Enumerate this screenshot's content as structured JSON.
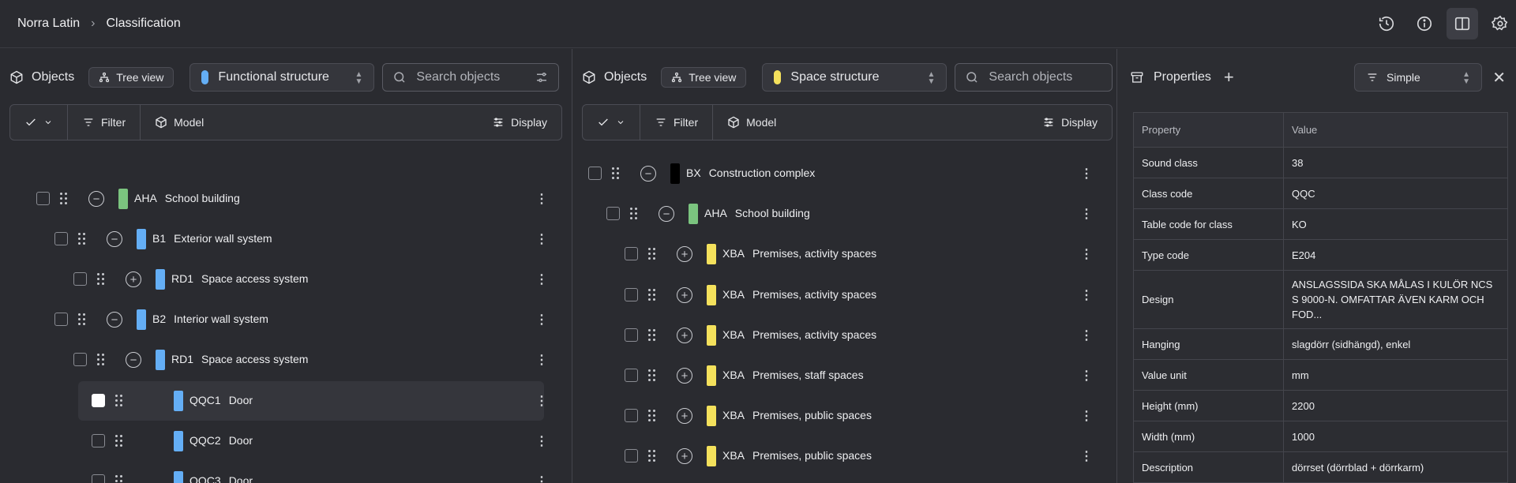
{
  "breadcrumb": {
    "project": "Norra Latin",
    "separator": "›",
    "page": "Classification"
  },
  "top_icons": [
    "history-icon",
    "info-icon",
    "split-view-icon",
    "settings-icon"
  ],
  "colors": {
    "green": "#7bc47f",
    "blue": "#64aef5",
    "yellow": "#f4e15c",
    "black": "#000000",
    "background": "#2a2b30"
  },
  "left_panel": {
    "objects_label": "Objects",
    "tree_view_label": "Tree view",
    "structure_label": "Functional structure",
    "structure_color": "#64aef5",
    "search_placeholder": "Search objects",
    "toolbar": {
      "filter": "Filter",
      "model": "Model",
      "display": "Display"
    },
    "rows": [
      {
        "code": "AHA",
        "name": "School building",
        "color": "#7bc47f",
        "toggle": "minus"
      },
      {
        "code": "B1",
        "name": "Exterior wall system",
        "color": "#64aef5",
        "toggle": "minus"
      },
      {
        "code": "RD1",
        "name": "Space access system",
        "color": "#64aef5",
        "toggle": "plus"
      },
      {
        "code": "B2",
        "name": "Interior wall system",
        "color": "#64aef5",
        "toggle": "minus"
      },
      {
        "code": "RD1",
        "name": "Space access system",
        "color": "#64aef5",
        "toggle": "minus"
      },
      {
        "code": "QQC1",
        "name": "Door",
        "color": "#64aef5",
        "toggle": "none",
        "selected": true
      },
      {
        "code": "QQC2",
        "name": "Door",
        "color": "#64aef5",
        "toggle": "none"
      },
      {
        "code": "QQC3",
        "name": "Door",
        "color": "#64aef5",
        "toggle": "none"
      }
    ]
  },
  "mid_panel": {
    "objects_label": "Objects",
    "tree_view_label": "Tree view",
    "structure_label": "Space structure",
    "structure_color": "#f4e15c",
    "search_placeholder": "Search objects",
    "toolbar": {
      "filter": "Filter",
      "model": "Model",
      "display": "Display"
    },
    "rows": [
      {
        "code": "BX",
        "name": "Construction complex",
        "color": "#000000",
        "toggle": "minus"
      },
      {
        "code": "AHA",
        "name": "School building",
        "color": "#7bc47f",
        "toggle": "minus"
      },
      {
        "code": "XBA",
        "name": "Premises, activity spaces",
        "color": "#f4e15c",
        "toggle": "plus"
      },
      {
        "code": "XBA",
        "name": "Premises, activity spaces",
        "color": "#f4e15c",
        "toggle": "plus"
      },
      {
        "code": "XBA",
        "name": "Premises, activity spaces",
        "color": "#f4e15c",
        "toggle": "plus"
      },
      {
        "code": "XBA",
        "name": "Premises, staff spaces",
        "color": "#f4e15c",
        "toggle": "plus"
      },
      {
        "code": "XBA",
        "name": "Premises, public spaces",
        "color": "#f4e15c",
        "toggle": "plus"
      },
      {
        "code": "XBA",
        "name": "Premises, public spaces",
        "color": "#f4e15c",
        "toggle": "plus"
      }
    ]
  },
  "properties": {
    "title": "Properties",
    "add_symbol": "+",
    "mode": "Simple",
    "close_symbol": "✕",
    "col_property": "Property",
    "col_value": "Value",
    "rows": [
      {
        "property": "Sound class",
        "value": "38"
      },
      {
        "property": "Class code",
        "value": "QQC"
      },
      {
        "property": "Table code for class",
        "value": "KO"
      },
      {
        "property": "Type code",
        "value": "E204"
      },
      {
        "property": "Design",
        "value": "ANSLAGSSIDA SKA MÅLAS I KULÖR NCS S 9000-N. OMFATTAR ÄVEN KARM OCH FOD..."
      },
      {
        "property": "Hanging",
        "value": "slagdörr (sidhängd), enkel"
      },
      {
        "property": "Value unit",
        "value": "mm"
      },
      {
        "property": "Height (mm)",
        "value": "2200"
      },
      {
        "property": "Width (mm)",
        "value": "1000"
      },
      {
        "property": "Description",
        "value": "dörrset (dörrblad + dörrkarm)"
      }
    ]
  }
}
